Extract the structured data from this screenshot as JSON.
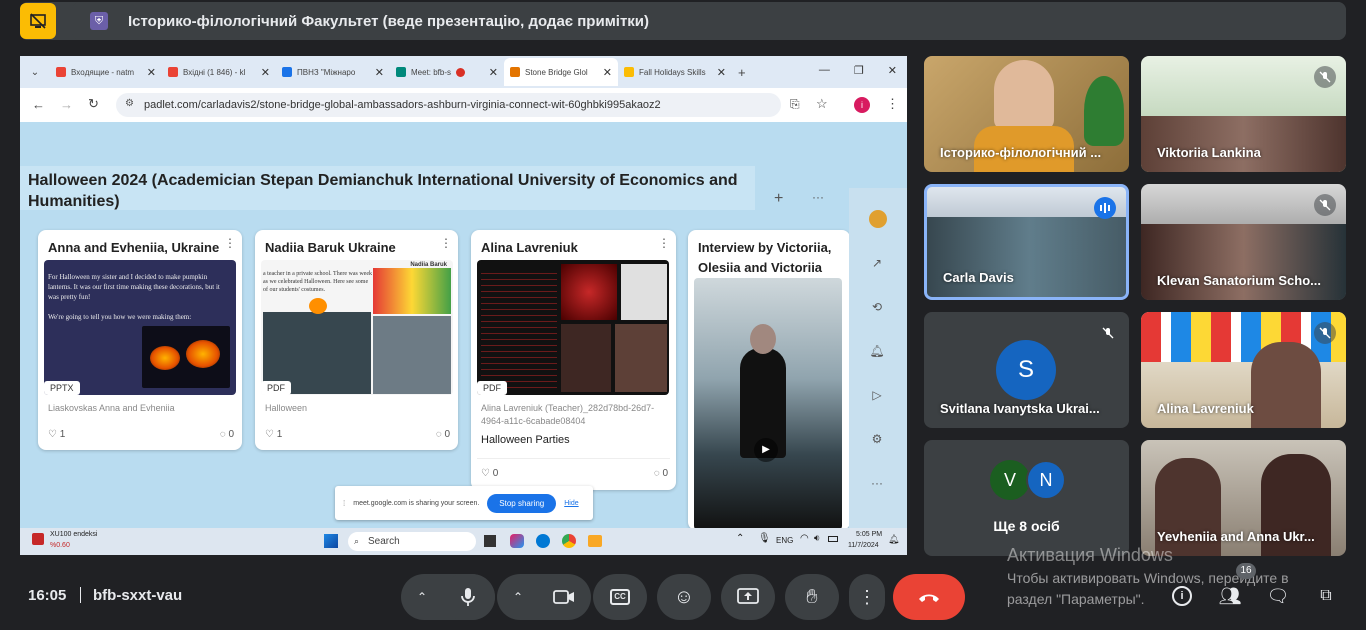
{
  "top_bar": {
    "title": "Історико-філологічний Факультет (веде презентацію, додає примітки)"
  },
  "browser": {
    "tabs": [
      {
        "label": "Вхoдящие - natm",
        "fav_color": "#ea4335"
      },
      {
        "label": "Вхідні (1 846) - kl",
        "fav_color": "#ea4335"
      },
      {
        "label": "ПВНЗ \"Міжнарo",
        "fav_color": "#1a73e8"
      },
      {
        "label": "Meet: bfb-s",
        "fav_color": "#00897b"
      },
      {
        "label": "Stone Bridge Glol",
        "fav_color": "#e37400"
      },
      {
        "label": "Fall Holidays Skills",
        "fav_color": "#fbbc04"
      }
    ],
    "url": "padlet.com/carladavis2/stone-bridge-global-ambassadors-ashburn-virginia-connect-wit-60ghbki995akaoz2"
  },
  "padlet": {
    "board_title": "Halloween 2024 (Academician Stepan Demianchuk International University of Economics and Humanities)",
    "cards": [
      {
        "title": "Anna and Evheniia, Ukraine",
        "tag": "PPTX",
        "meta": "Liaskovskas Anna and Evheniia",
        "likes": "1",
        "comments": "0",
        "thumb_text": "For Halloween my sister and I decided to make pumpkin lanterns. It was our first time making these decorations, but it was pretty fun!\n\nWe're going to tell you how we were making them:"
      },
      {
        "title": "Nadiia Baruk Ukraine",
        "tag": "PDF",
        "meta": "Halloween",
        "likes": "1",
        "comments": "0",
        "thumb_text": "a teacher in a private school. There was week as we celebrated Halloween. Here see some of our students' costumes.",
        "thumb_label": "Nadiia Baruk"
      },
      {
        "title": "Alina Lavreniuk",
        "tag": "PDF",
        "meta": "Alina Lavreniuk (Teacher)_282d78bd-26d7-4964-a11c-6cabade08404",
        "subtitle": "Halloween Parties",
        "likes": "0",
        "comments": "0"
      },
      {
        "title": "Interview by Victoriia, Olesiia and Victoriia"
      }
    ],
    "fab": "+"
  },
  "share_banner": {
    "text": "meet.google.com is sharing your screen.",
    "stop": "Stop sharing",
    "hide": "Hide"
  },
  "taskbar": {
    "stock": "XU100 endeksi",
    "stock_change": "%0.60",
    "search": "Search",
    "lang": "ENG",
    "time": "5:05 PM",
    "date": "11/7/2024"
  },
  "participants": [
    {
      "name": "Історико-філологічний ...",
      "muted": false
    },
    {
      "name": "Viktoriia Lankina",
      "muted": true
    },
    {
      "name": "Carla Davis",
      "muted": false,
      "speaking": true
    },
    {
      "name": "Klevan Sanatorium Scho...",
      "muted": true
    },
    {
      "name": "Svitlana Ivanytska Ukrai...",
      "muted": true,
      "initial": "S",
      "avatar_color": "#1565c0"
    },
    {
      "name": "Alina Lavreniuk",
      "muted": true
    },
    {
      "name": "Ще 8 осіб",
      "initials": [
        "V",
        "N"
      ],
      "avatar_colors": [
        "#1b5e20",
        "#1565c0"
      ]
    },
    {
      "name": "Yevheniia and Anna Ukr...",
      "muted": false
    }
  ],
  "bottom": {
    "time": "16:05",
    "meeting_code": "bfb-sxxt-vau",
    "people_count": "16"
  },
  "watermark": {
    "line1": "Активация Windows",
    "line2": "Чтобы активировать Windows, перейдите в раздел \"Параметры\"."
  },
  "colors": {
    "end_call": "#ea4335",
    "present_active": "#fbbc04",
    "speaking_border": "#8ab4f8"
  }
}
